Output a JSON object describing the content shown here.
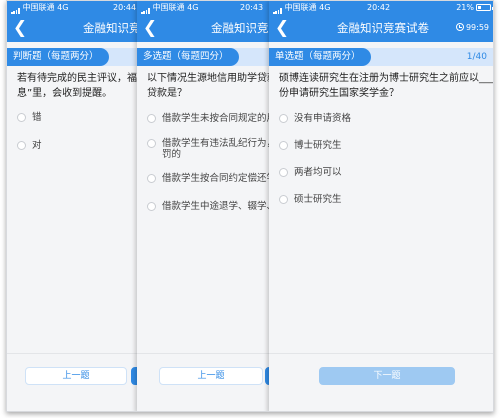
{
  "status_left": {
    "carrier": "中国联通",
    "network": "4G"
  },
  "battery_percent": "21%",
  "panels": [
    {
      "time": "20:44",
      "title": "金融知识竞赛",
      "question_type": "判断题（每题两分）",
      "question_lines": [
        "若有待完成的民主评议，福建",
        "息”里，会收到提醒。"
      ],
      "options": [
        "错",
        "对"
      ],
      "prev_label": "上一题"
    },
    {
      "time": "20:43",
      "title": "金融知识竞赛",
      "question_type": "多选题（每题四分）",
      "question_lines": [
        "以下情况生源地信用助学贷款",
        "贷款是？"
      ],
      "options": [
        [
          "借款学生未按合同规定的用途"
        ],
        [
          "借款学生有违法乱纪行为，受",
          "罚的"
        ],
        [
          "借款学生按合同约定偿还学"
        ],
        [
          "借款学生中途退学、辍学、被"
        ]
      ],
      "prev_label": "上一题"
    },
    {
      "time": "20:42",
      "title": "金融知识竞赛试卷",
      "timer": "99:59",
      "question_type": "单选题（每题两分）",
      "progress": "1/40",
      "question_lines": [
        "硕博连读研究生在注册为博士研究生之前应以____身",
        "份申请研究生国家奖学金？"
      ],
      "options": [
        "没有申请资格",
        "博士研究生",
        "两者均可以",
        "硕士研究生"
      ],
      "next_label": "下一题"
    }
  ]
}
